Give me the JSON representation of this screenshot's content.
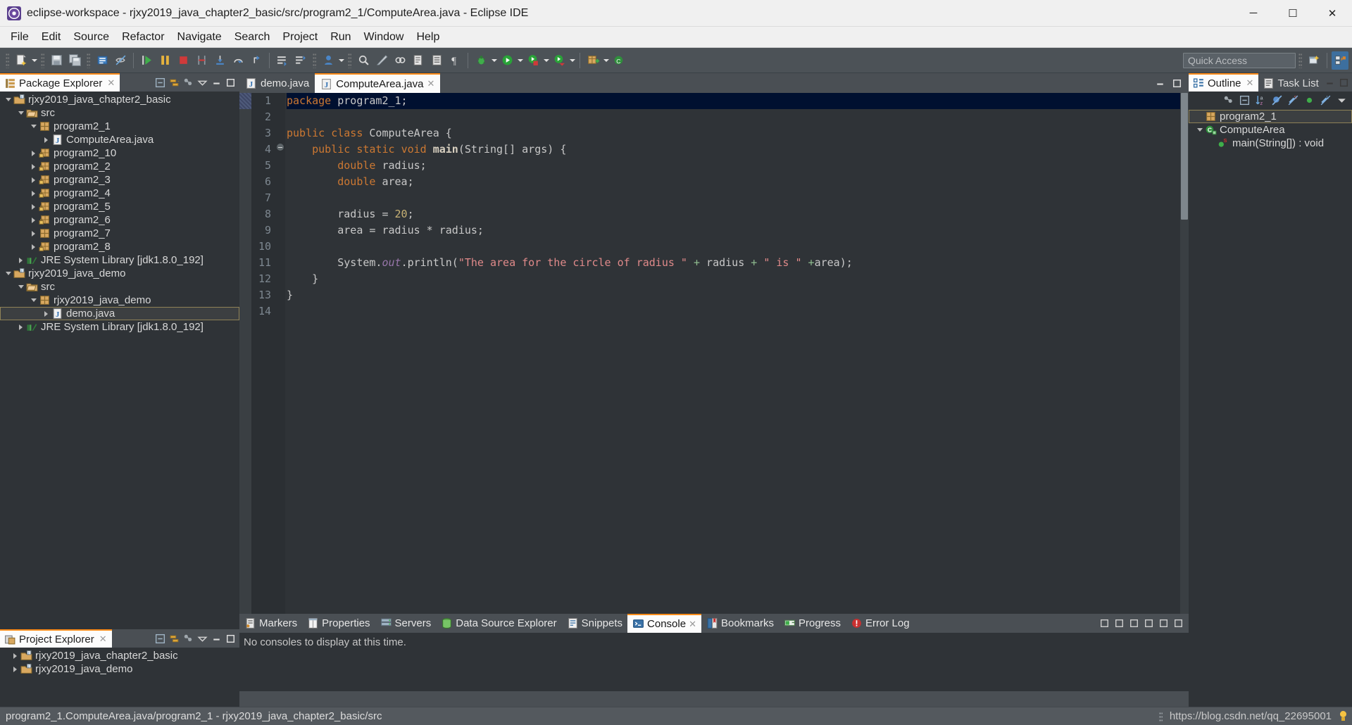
{
  "window": {
    "title": "eclipse-workspace - rjxy2019_java_chapter2_basic/src/program2_1/ComputeArea.java - Eclipse IDE",
    "app_icon": "eclipse-icon",
    "minimize": "─",
    "maximize": "☐",
    "close": "✕"
  },
  "menubar": {
    "items": [
      {
        "label": "File"
      },
      {
        "label": "Edit"
      },
      {
        "label": "Source"
      },
      {
        "label": "Refactor"
      },
      {
        "label": "Navigate"
      },
      {
        "label": "Search"
      },
      {
        "label": "Project"
      },
      {
        "label": "Run"
      },
      {
        "label": "Window"
      },
      {
        "label": "Help"
      }
    ]
  },
  "toolbar": {
    "groups": [
      {
        "icons": [
          "new-wizard-icon",
          "new-wizard-dropdown"
        ]
      },
      {
        "icons": [
          "save-icon",
          "save-all-icon"
        ]
      },
      {
        "icons": [
          "print-icon",
          "toggle-markoccurrences-icon"
        ]
      },
      {
        "icons": [
          "resume-icon",
          "suspend-icon",
          "terminate-icon",
          "disconnect-icon",
          "step-into-icon",
          "step-over-icon",
          "step-return-icon"
        ]
      },
      {
        "icons": [
          "open-task-icon",
          "new-task-icon"
        ]
      },
      {
        "icons": [
          "new-java-project-icon",
          "new-java-project-dropdown"
        ]
      },
      {
        "icons": [
          "search-icon",
          "build-icon",
          "link-icon",
          "open-type-icon",
          "open-task-list-icon",
          "pilcrow-icon"
        ]
      },
      {
        "icons": [
          "debug-icon",
          "debug-dropdown",
          "run-icon",
          "run-dropdown",
          "run-external-icon",
          "run-external-dropdown",
          "coverage-icon",
          "coverage-dropdown"
        ]
      },
      {
        "icons": [
          "new-package-icon",
          "new-package-dropdown",
          "new-class-icon"
        ]
      }
    ],
    "quick_access_placeholder": "Quick Access",
    "perspective_icons": [
      "open-perspective-icon",
      "java-perspective-icon"
    ]
  },
  "package_explorer": {
    "tab_label": "Package Explorer",
    "tab_icon": "package-explorer-icon",
    "close_glyph": "✕",
    "toolbar_icons": [
      "collapse-all-icon",
      "link-with-editor-icon",
      "view-menu-icon",
      "minimize-icon",
      "maximize-icon"
    ],
    "tree": [
      {
        "indent": 0,
        "twisty": "open",
        "icon": "java-project-icon",
        "label": "rjxy2019_java_chapter2_basic",
        "selected": false
      },
      {
        "indent": 1,
        "twisty": "open",
        "icon": "source-folder-icon",
        "label": "src",
        "selected": false
      },
      {
        "indent": 2,
        "twisty": "open",
        "icon": "package-icon",
        "label": "program2_1",
        "selected": false
      },
      {
        "indent": 3,
        "twisty": "closed",
        "icon": "java-file-icon",
        "label": "ComputeArea.java",
        "selected": false
      },
      {
        "indent": 2,
        "twisty": "closed",
        "icon": "package-lock-icon",
        "label": "program2_10",
        "selected": false
      },
      {
        "indent": 2,
        "twisty": "closed",
        "icon": "package-lock-icon",
        "label": "program2_2",
        "selected": false
      },
      {
        "indent": 2,
        "twisty": "closed",
        "icon": "package-lock-icon",
        "label": "program2_3",
        "selected": false
      },
      {
        "indent": 2,
        "twisty": "closed",
        "icon": "package-lock-icon",
        "label": "program2_4",
        "selected": false
      },
      {
        "indent": 2,
        "twisty": "closed",
        "icon": "package-lock-icon",
        "label": "program2_5",
        "selected": false
      },
      {
        "indent": 2,
        "twisty": "closed",
        "icon": "package-lock-icon",
        "label": "program2_6",
        "selected": false
      },
      {
        "indent": 2,
        "twisty": "closed",
        "icon": "package-icon",
        "label": "program2_7",
        "selected": false
      },
      {
        "indent": 2,
        "twisty": "closed",
        "icon": "package-lock-icon",
        "label": "program2_8",
        "selected": false
      },
      {
        "indent": 1,
        "twisty": "closed",
        "icon": "jre-library-icon",
        "label": "JRE System Library [jdk1.8.0_192]",
        "selected": false
      },
      {
        "indent": 0,
        "twisty": "open",
        "icon": "java-project-icon",
        "label": "rjxy2019_java_demo",
        "selected": false
      },
      {
        "indent": 1,
        "twisty": "open",
        "icon": "source-folder-icon",
        "label": "src",
        "selected": false
      },
      {
        "indent": 2,
        "twisty": "open",
        "icon": "package-icon",
        "label": "rjxy2019_java_demo",
        "selected": false
      },
      {
        "indent": 3,
        "twisty": "closed",
        "icon": "java-file-icon",
        "label": "demo.java",
        "selected": true
      },
      {
        "indent": 1,
        "twisty": "closed",
        "icon": "jre-library-icon",
        "label": "JRE System Library [jdk1.8.0_192]",
        "selected": false
      }
    ]
  },
  "project_explorer": {
    "tab_label": "Project Explorer",
    "tab_icon": "project-explorer-icon",
    "close_glyph": "✕",
    "toolbar_icons": [
      "collapse-all-icon",
      "link-with-editor-icon",
      "view-menu-icon",
      "minimize-icon",
      "maximize-icon"
    ],
    "tree": [
      {
        "indent": 0,
        "twisty": "closed",
        "icon": "java-project-icon",
        "label": "rjxy2019_java_chapter2_basic"
      },
      {
        "indent": 0,
        "twisty": "closed",
        "icon": "java-project-icon",
        "label": "rjxy2019_java_demo"
      }
    ]
  },
  "editor": {
    "tabs": [
      {
        "label": "demo.java",
        "icon": "java-file-icon",
        "active": false,
        "close_glyph": ""
      },
      {
        "label": "ComputeArea.java",
        "icon": "java-file-icon",
        "active": true,
        "close_glyph": "✕"
      }
    ],
    "minimize_glyph": "─",
    "maximize_glyph": "☐",
    "lines": [
      {
        "n": "1",
        "highlight": true,
        "tokens": [
          {
            "t": "package",
            "c": "k"
          },
          {
            "t": " program2_1;",
            "c": "plain"
          }
        ]
      },
      {
        "n": "2",
        "highlight": false,
        "tokens": []
      },
      {
        "n": "3",
        "highlight": false,
        "tokens": [
          {
            "t": "public",
            "c": "k"
          },
          {
            "t": " ",
            "c": "plain"
          },
          {
            "t": "class",
            "c": "k"
          },
          {
            "t": " ComputeArea {",
            "c": "plain"
          }
        ]
      },
      {
        "n": "4",
        "highlight": false,
        "fold": true,
        "tokens": [
          {
            "t": "    ",
            "c": "plain"
          },
          {
            "t": "public",
            "c": "k"
          },
          {
            "t": " ",
            "c": "plain"
          },
          {
            "t": "static",
            "c": "k"
          },
          {
            "t": " ",
            "c": "plain"
          },
          {
            "t": "void",
            "c": "k"
          },
          {
            "t": " ",
            "c": "plain"
          },
          {
            "t": "main",
            "c": "mth"
          },
          {
            "t": "(String[] args) {",
            "c": "plain"
          }
        ]
      },
      {
        "n": "5",
        "highlight": false,
        "tokens": [
          {
            "t": "        ",
            "c": "plain"
          },
          {
            "t": "double",
            "c": "k"
          },
          {
            "t": " radius;",
            "c": "plain"
          }
        ]
      },
      {
        "n": "6",
        "highlight": false,
        "tokens": [
          {
            "t": "        ",
            "c": "plain"
          },
          {
            "t": "double",
            "c": "k"
          },
          {
            "t": " area;",
            "c": "plain"
          }
        ]
      },
      {
        "n": "7",
        "highlight": false,
        "tokens": []
      },
      {
        "n": "8",
        "highlight": false,
        "tokens": [
          {
            "t": "        radius = ",
            "c": "plain"
          },
          {
            "t": "20",
            "c": "num"
          },
          {
            "t": ";",
            "c": "plain"
          }
        ]
      },
      {
        "n": "9",
        "highlight": false,
        "tokens": [
          {
            "t": "        area = radius * radius;",
            "c": "plain"
          }
        ]
      },
      {
        "n": "10",
        "highlight": false,
        "tokens": []
      },
      {
        "n": "11",
        "highlight": false,
        "tokens": [
          {
            "t": "        System.",
            "c": "plain"
          },
          {
            "t": "out",
            "c": "fld"
          },
          {
            "t": ".println(",
            "c": "plain"
          },
          {
            "t": "\"The area for the circle of radius \"",
            "c": "str"
          },
          {
            "t": " + ",
            "c": "gr"
          },
          {
            "t": "radius",
            "c": "plain"
          },
          {
            "t": " + ",
            "c": "gr"
          },
          {
            "t": "\" is \"",
            "c": "str"
          },
          {
            "t": " +",
            "c": "gr"
          },
          {
            "t": "area);",
            "c": "plain"
          }
        ]
      },
      {
        "n": "12",
        "highlight": false,
        "tokens": [
          {
            "t": "    }",
            "c": "plain"
          }
        ]
      },
      {
        "n": "13",
        "highlight": false,
        "tokens": [
          {
            "t": "}",
            "c": "plain"
          }
        ]
      },
      {
        "n": "14",
        "highlight": false,
        "tokens": []
      }
    ]
  },
  "outline": {
    "tabs": [
      {
        "label": "Outline",
        "icon": "outline-icon",
        "active": true,
        "close_glyph": "✕"
      },
      {
        "label": "Task List",
        "icon": "task-list-icon",
        "active": false,
        "close_glyph": ""
      }
    ],
    "minimize_glyph": "─",
    "maximize_glyph": "☐",
    "toolbar_icons": [
      "focus-on-active-task-icon",
      "collapse-all-icon",
      "sort-az-icon",
      "hide-fields-icon",
      "hide-static-icon",
      "hide-nonpublic-icon",
      "hide-local-icon",
      "view-menu-icon"
    ],
    "tree": [
      {
        "indent": 0,
        "twisty": "none",
        "icon": "package-icon",
        "label": "program2_1",
        "selected": true
      },
      {
        "indent": 0,
        "twisty": "open",
        "icon": "class-icon",
        "label": "ComputeArea",
        "selected": false
      },
      {
        "indent": 1,
        "twisty": "none",
        "icon": "method-public-static-icon",
        "label": "main(String[]) : void",
        "selected": false
      }
    ]
  },
  "bottom_panel": {
    "tabs": [
      {
        "label": "Markers",
        "icon": "markers-icon",
        "active": false,
        "close_glyph": ""
      },
      {
        "label": "Properties",
        "icon": "properties-icon",
        "active": false,
        "close_glyph": ""
      },
      {
        "label": "Servers",
        "icon": "servers-icon",
        "active": false,
        "close_glyph": ""
      },
      {
        "label": "Data Source Explorer",
        "icon": "data-source-explorer-icon",
        "active": false,
        "close_glyph": ""
      },
      {
        "label": "Snippets",
        "icon": "snippets-icon",
        "active": false,
        "close_glyph": ""
      },
      {
        "label": "Console",
        "icon": "console-icon",
        "active": true,
        "close_glyph": "✕"
      },
      {
        "label": "Bookmarks",
        "icon": "bookmarks-icon",
        "active": false,
        "close_glyph": ""
      },
      {
        "label": "Progress",
        "icon": "progress-icon",
        "active": false,
        "close_glyph": ""
      },
      {
        "label": "Error Log",
        "icon": "error-log-icon",
        "active": false,
        "close_glyph": ""
      }
    ],
    "console_message": "No consoles to display at this time.",
    "toolbar_icons": [
      "pin-console-icon",
      "minimize-icon",
      "maximize-icon",
      "new-console-icon",
      "console-menu-icon",
      "view-menu-icon"
    ]
  },
  "statusbar": {
    "message": "program2_1.ComputeArea.java/program2_1 - rjxy2019_java_chapter2_basic/src",
    "watermark": "https://blog.csdn.net/qq_22695001",
    "smart_insert_icon": "bulb-icon"
  },
  "colors": {
    "accent_orange": "#ff8c1a",
    "editor_bg": "#2f3337",
    "panel_bg": "#2f3337",
    "chrome_bg": "#4a4f54",
    "highlight_line": "#001030",
    "keyword": "#cc7832",
    "string": "#e08a8a",
    "number": "#c8b275",
    "field_italic": "#9876aa"
  }
}
